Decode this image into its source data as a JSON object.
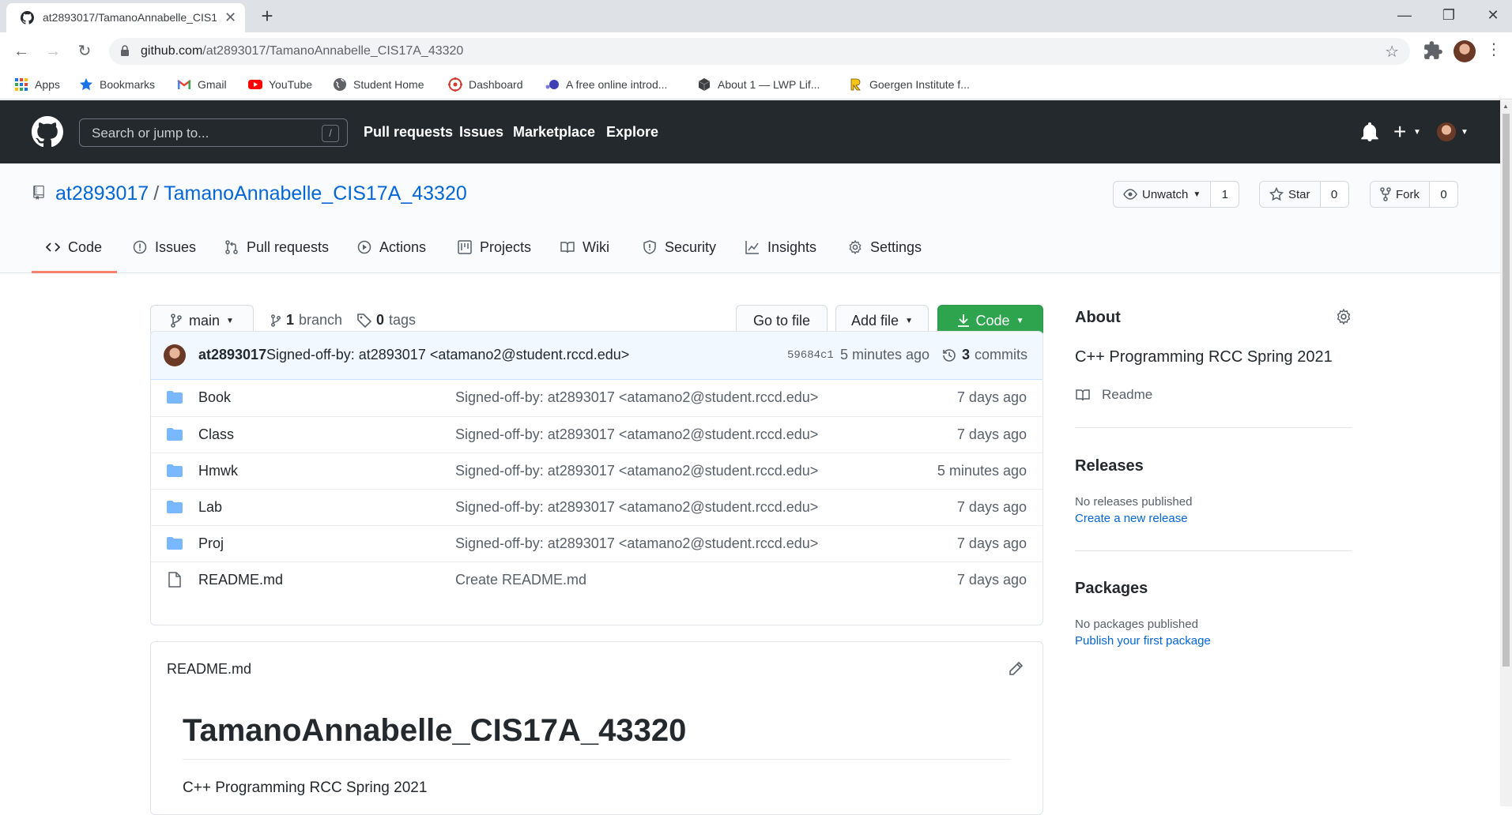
{
  "browser": {
    "tab_title": "at2893017/TamanoAnnabelle_CIS17A_43320",
    "url_host": "github.com",
    "url_path": "/at2893017/TamanoAnnabelle_CIS17A_43320",
    "bookmarks": [
      {
        "label": "Apps",
        "icon": "apps-grid-icon"
      },
      {
        "label": "Bookmarks",
        "icon": "star-icon"
      },
      {
        "label": "Gmail",
        "icon": "gmail-icon"
      },
      {
        "label": "YouTube",
        "icon": "youtube-icon"
      },
      {
        "label": "Student Home",
        "icon": "globe-icon"
      },
      {
        "label": "Dashboard",
        "icon": "dashboard-icon"
      },
      {
        "label": "A free online introd...",
        "icon": "bookmark-site-icon"
      },
      {
        "label": "About 1 — LWP Lif...",
        "icon": "cube-icon"
      },
      {
        "label": "Goergen Institute f...",
        "icon": "r-logo-icon"
      }
    ]
  },
  "github": {
    "search_placeholder": "Search or jump to...",
    "search_shortcut": "/",
    "nav": [
      "Pull requests",
      "Issues",
      "Marketplace",
      "Explore"
    ]
  },
  "repo": {
    "owner": "at2893017",
    "separator": "/",
    "name": "TamanoAnnabelle_CIS17A_43320",
    "unwatch_label": "Unwatch",
    "watch_count": "1",
    "star_label": "Star",
    "star_count": "0",
    "fork_label": "Fork",
    "fork_count": "0",
    "tabs": [
      {
        "label": "Code",
        "icon": "code-icon",
        "active": true
      },
      {
        "label": "Issues",
        "icon": "issue-icon"
      },
      {
        "label": "Pull requests",
        "icon": "pull-request-icon"
      },
      {
        "label": "Actions",
        "icon": "play-icon"
      },
      {
        "label": "Projects",
        "icon": "project-icon"
      },
      {
        "label": "Wiki",
        "icon": "book-icon"
      },
      {
        "label": "Security",
        "icon": "shield-icon"
      },
      {
        "label": "Insights",
        "icon": "graph-icon"
      },
      {
        "label": "Settings",
        "icon": "gear-icon"
      }
    ]
  },
  "branchbar": {
    "branch": "main",
    "branch_count": "1",
    "branch_word": "branch",
    "tag_count": "0",
    "tag_word": "tags",
    "go_to_file": "Go to file",
    "add_file": "Add file",
    "code": "Code"
  },
  "latest_commit": {
    "author": "at2893017",
    "message": "Signed-off-by: at2893017 <atamano2@student.rccd.edu>",
    "sha": "59684c1",
    "time": "5 minutes ago",
    "commit_count": "3",
    "commit_word": "commits"
  },
  "files": [
    {
      "name": "Book",
      "type": "folder",
      "message": "Signed-off-by: at2893017 <atamano2@student.rccd.edu>",
      "time": "7 days ago"
    },
    {
      "name": "Class",
      "type": "folder",
      "message": "Signed-off-by: at2893017 <atamano2@student.rccd.edu>",
      "time": "7 days ago"
    },
    {
      "name": "Hmwk",
      "type": "folder",
      "message": "Signed-off-by: at2893017 <atamano2@student.rccd.edu>",
      "time": "5 minutes ago"
    },
    {
      "name": "Lab",
      "type": "folder",
      "message": "Signed-off-by: at2893017 <atamano2@student.rccd.edu>",
      "time": "7 days ago"
    },
    {
      "name": "Proj",
      "type": "folder",
      "message": "Signed-off-by: at2893017 <atamano2@student.rccd.edu>",
      "time": "7 days ago"
    },
    {
      "name": "README.md",
      "type": "file",
      "message": "Create README.md",
      "time": "7 days ago"
    }
  ],
  "readme": {
    "filename": "README.md",
    "heading": "TamanoAnnabelle_CIS17A_43320",
    "body": "C++ Programming RCC Spring 2021"
  },
  "sidebar": {
    "about_title": "About",
    "description": "C++ Programming RCC Spring 2021",
    "readme_link": "Readme",
    "releases_title": "Releases",
    "releases_empty": "No releases published",
    "releases_link": "Create a new release",
    "packages_title": "Packages",
    "packages_empty": "No packages published",
    "packages_link": "Publish your first package"
  },
  "colors": {
    "header_bg": "#24292e",
    "link": "#0366d6",
    "green_button": "#2ea44f",
    "active_tab_underline": "#f9826c",
    "folder": "#79b8ff"
  }
}
